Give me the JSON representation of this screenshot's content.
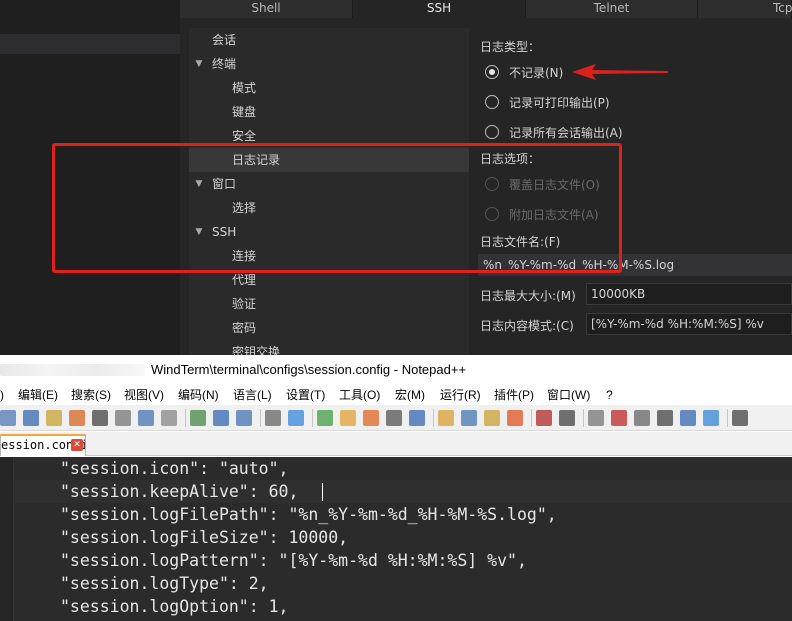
{
  "windterm": {
    "tabs": [
      "Shell",
      "SSH",
      "Telnet",
      "Tcp"
    ],
    "active_tab": "SSH",
    "tree": [
      {
        "label": "会话",
        "level": 0,
        "expanded": null
      },
      {
        "label": "终端",
        "level": 0,
        "expanded": true
      },
      {
        "label": "模式",
        "level": 1,
        "expanded": null
      },
      {
        "label": "键盘",
        "level": 1,
        "expanded": null
      },
      {
        "label": "安全",
        "level": 1,
        "expanded": null
      },
      {
        "label": "日志记录",
        "level": 1,
        "expanded": null,
        "selected": true
      },
      {
        "label": "窗口",
        "level": 0,
        "expanded": true
      },
      {
        "label": "选择",
        "level": 1,
        "expanded": null
      },
      {
        "label": "SSH",
        "level": 0,
        "expanded": true
      },
      {
        "label": "连接",
        "level": 1,
        "expanded": null
      },
      {
        "label": "代理",
        "level": 1,
        "expanded": null
      },
      {
        "label": "验证",
        "level": 1,
        "expanded": null
      },
      {
        "label": "密码",
        "level": 1,
        "expanded": null
      },
      {
        "label": "密钥交换",
        "level": 1,
        "expanded": null
      }
    ],
    "log_type_label": "日志类型：",
    "log_type_options": [
      {
        "label": "不记录(N)",
        "checked": true,
        "disabled": false
      },
      {
        "label": "记录可打印输出(P)",
        "checked": false,
        "disabled": false
      },
      {
        "label": "记录所有会话输出(A)",
        "checked": false,
        "disabled": false
      }
    ],
    "log_options_label": "日志选项：",
    "log_options": [
      {
        "label": "覆盖日志文件(O)",
        "checked": false,
        "disabled": true
      },
      {
        "label": "附加日志文件(A)",
        "checked": false,
        "disabled": true
      }
    ],
    "log_filename_label": "日志文件名:(F)",
    "log_filename_value": "%n_%Y-%m-%d_%H-%M-%S.log",
    "log_maxsize_label": "日志最大大小:(M)",
    "log_maxsize_value": "10000KB",
    "log_pattern_label": "日志内容模式:(C)",
    "log_pattern_value": "[%Y-%m-%d %H:%M:%S] %v"
  },
  "notepad": {
    "title": "WindTerm\\terminal\\configs\\session.config - Notepad++",
    "menu": [
      "编辑(E)",
      "搜索(S)",
      "视图(V)",
      "编码(N)",
      "语言(L)",
      "设置(T)",
      "工具(O)",
      "宏(M)",
      "运行(R)",
      "插件(P)",
      "窗口(W)",
      "?"
    ],
    "file_tab": "ession.config",
    "code_lines": [
      "\"session.icon\": \"auto\",",
      "\"session.keepAlive\": 60,",
      "\"session.logFilePath\": \"%n_%Y-%m-%d_%H-%M-%S.log\",",
      "\"session.logFileSize\": 10000,",
      "\"session.logPattern\": \"[%Y-%m-%d %H:%M:%S] %v\",",
      "\"session.logType\": 2,",
      "\"session.logOption\": 1,"
    ],
    "highlight_color": "#e0201c",
    "arrow_color": "#e0201c"
  }
}
